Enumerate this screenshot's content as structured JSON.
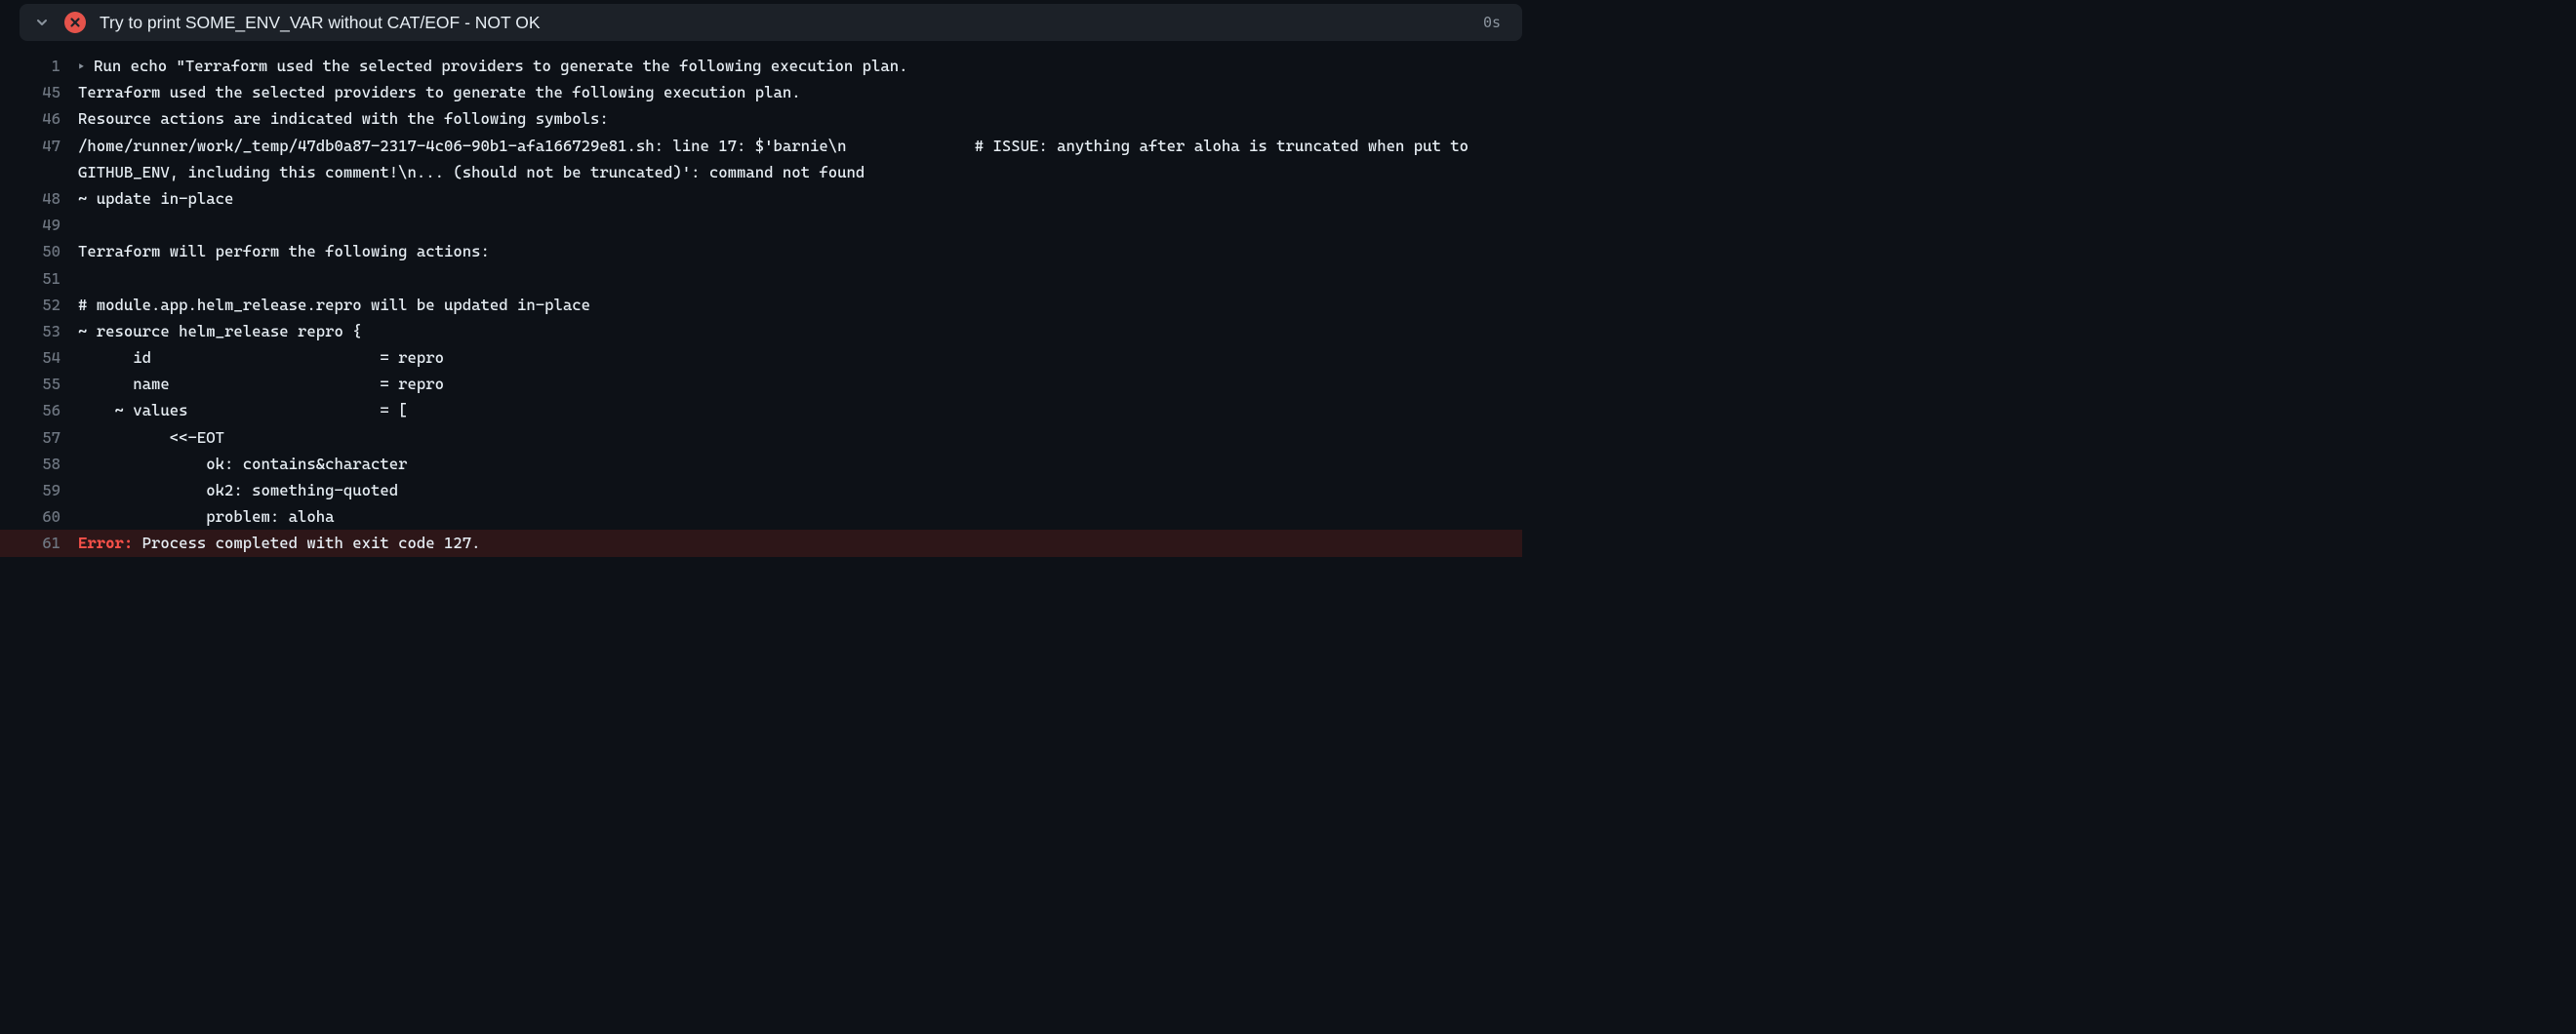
{
  "step": {
    "title": "Try to print SOME_ENV_VAR without CAT/EOF - NOT OK",
    "duration": "0s",
    "status": "error"
  },
  "log_lines": [
    {
      "num": "1",
      "caret": true,
      "text": "Run echo \"Terraform used the selected providers to generate the following execution plan."
    },
    {
      "num": "45",
      "caret": false,
      "text": "Terraform used the selected providers to generate the following execution plan."
    },
    {
      "num": "46",
      "caret": false,
      "text": "Resource actions are indicated with the following symbols:"
    },
    {
      "num": "47",
      "caret": false,
      "text": "/home/runner/work/_temp/47db0a87-2317-4c06-90b1-afa166729e81.sh: line 17: $'barnie\\n              # ISSUE: anything after aloha is truncated when put to GITHUB_ENV, including this comment!\\n... (should not be truncated)': command not found"
    },
    {
      "num": "48",
      "caret": false,
      "text": "~ update in-place"
    },
    {
      "num": "49",
      "caret": false,
      "text": ""
    },
    {
      "num": "50",
      "caret": false,
      "text": "Terraform will perform the following actions:"
    },
    {
      "num": "51",
      "caret": false,
      "text": ""
    },
    {
      "num": "52",
      "caret": false,
      "text": "# module.app.helm_release.repro will be updated in-place"
    },
    {
      "num": "53",
      "caret": false,
      "text": "~ resource helm_release repro {"
    },
    {
      "num": "54",
      "caret": false,
      "text": "      id                         = repro"
    },
    {
      "num": "55",
      "caret": false,
      "text": "      name                       = repro"
    },
    {
      "num": "56",
      "caret": false,
      "text": "    ~ values                     = ["
    },
    {
      "num": "57",
      "caret": false,
      "text": "          <<-EOT"
    },
    {
      "num": "58",
      "caret": false,
      "text": "              ok: contains&character"
    },
    {
      "num": "59",
      "caret": false,
      "text": "              ok2: something-quoted"
    },
    {
      "num": "60",
      "caret": false,
      "text": "              problem: aloha"
    },
    {
      "num": "61",
      "caret": false,
      "error": true,
      "error_label": "Error:",
      "text": " Process completed with exit code 127."
    }
  ]
}
